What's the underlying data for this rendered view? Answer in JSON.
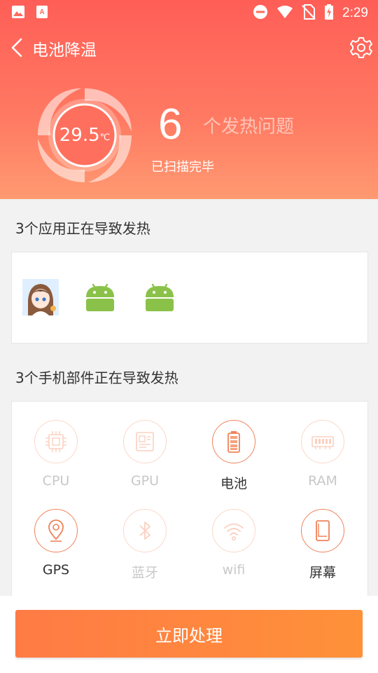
{
  "status_bar": {
    "time": "2:29",
    "left_icons": [
      "image-icon",
      "pdf-app-icon"
    ],
    "right_icons": [
      "dnd-icon",
      "wifi-icon",
      "no-sim-icon",
      "battery-charging-icon"
    ]
  },
  "titlebar": {
    "title": "电池降温",
    "back_icon": "back-chevron-icon",
    "settings_icon": "gear-icon"
  },
  "summary": {
    "temperature_value": "29.5",
    "temperature_unit": "℃",
    "issue_count": "6",
    "issue_label": "个发热问题",
    "scan_status": "已扫描完毕"
  },
  "apps_section": {
    "title": "3个应用正在导致发热",
    "apps": [
      {
        "icon": "anime-avatar-app-icon"
      },
      {
        "icon": "android-robot-icon"
      },
      {
        "icon": "android-robot-icon"
      }
    ]
  },
  "components_section": {
    "title": "3个手机部件正在导致发热",
    "items": [
      {
        "label": "CPU",
        "icon": "cpu-chip-icon",
        "active": false
      },
      {
        "label": "GPU",
        "icon": "gpu-board-icon",
        "active": false
      },
      {
        "label": "电池",
        "icon": "battery-icon",
        "active": true
      },
      {
        "label": "RAM",
        "icon": "ram-module-icon",
        "active": false
      },
      {
        "label": "GPS",
        "icon": "location-pin-icon",
        "active": true
      },
      {
        "label": "蓝牙",
        "icon": "bluetooth-icon",
        "active": false
      },
      {
        "label": "wifi",
        "icon": "wifi-signal-icon",
        "active": false
      },
      {
        "label": "屏幕",
        "icon": "phone-screen-icon",
        "active": true
      }
    ]
  },
  "action": {
    "label": "立即处理"
  },
  "colors": {
    "header_top": "#ff5e57",
    "header_bottom": "#ff9a72",
    "accent_orange": "#f0825a",
    "button": "#ff8a3d",
    "android_green": "#8ac249"
  }
}
